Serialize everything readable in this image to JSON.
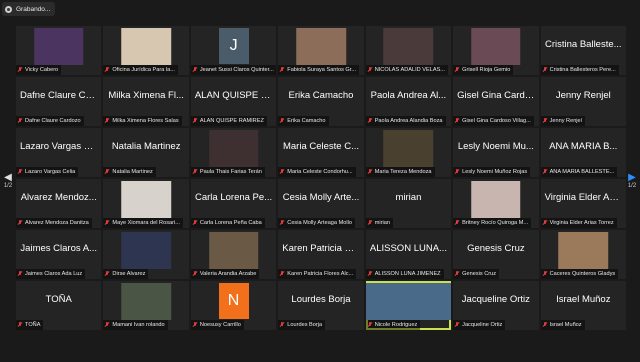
{
  "recording": {
    "label": "Grabando..."
  },
  "pager": {
    "left": "1/2",
    "right": "1/2"
  },
  "tiles": [
    {
      "type": "video",
      "name": "Vicky Cabero",
      "photo": "#4b3560"
    },
    {
      "type": "video",
      "name": "Oficina Jurídica Para la...",
      "photo": "#d7c7b0"
    },
    {
      "type": "avatar",
      "initial": "J",
      "name": "Jeanet Sussi Claros Quinter..."
    },
    {
      "type": "video",
      "name": "Fabiola Suraya Santos Gr...",
      "photo": "#8b6d5a"
    },
    {
      "type": "video",
      "name": "NICOLAS ADALID VELAS...",
      "photo": "#4a3a3a"
    },
    {
      "type": "video",
      "name": "Grisell Rioja Gemio",
      "photo": "#6a4a55"
    },
    {
      "type": "text",
      "big": "Cristina Balleste...",
      "name": "Cristina Ballesteros Pere..."
    },
    {
      "type": "text",
      "big": "Dafne Claure Ca...",
      "name": "Dafne Claure Cardozo"
    },
    {
      "type": "text",
      "big": "Milka Ximena Fl...",
      "name": "Milka Ximena Flores Salas"
    },
    {
      "type": "text",
      "big": "ALAN QUISPE R...",
      "name": "ALAN QUISPE RAMIREZ"
    },
    {
      "type": "text",
      "big": "Erika Camacho",
      "name": "Erika Camacho"
    },
    {
      "type": "text",
      "big": "Paola Andrea Al...",
      "name": "Paola Andrea Alandia Boza"
    },
    {
      "type": "text",
      "big": "Gisel Gina Cardo...",
      "name": "Gisel Gina Cardoso Villag..."
    },
    {
      "type": "text",
      "big": "Jenny Renjel",
      "name": "Jenny Renjel"
    },
    {
      "type": "text",
      "big": "Lazaro Vargas C...",
      "name": "Lazaro Vargas Celia"
    },
    {
      "type": "text",
      "big": "Natalia Martinez",
      "name": "Natalia Martinez"
    },
    {
      "type": "video",
      "name": "Paula Thais Farias Terán",
      "photo": "#3e3030"
    },
    {
      "type": "text",
      "big": "Maria Celeste C...",
      "name": "Maria Celeste Condorhu..."
    },
    {
      "type": "video",
      "name": "Maria Tereza Mendoza",
      "photo": "#4a4030"
    },
    {
      "type": "text",
      "big": "Lesly Noemi Mu...",
      "name": "Lesly Noemi Muñoz Rojas"
    },
    {
      "type": "text",
      "big": "ANA MARIA  B...",
      "name": "ANA MARIA  BALLESTE..."
    },
    {
      "type": "text",
      "big": "Alvarez Mendoz...",
      "name": "Alvarez Mendoza Danitza"
    },
    {
      "type": "video",
      "name": "Maye Xiomara del Rosari...",
      "photo": "#d8d2cc"
    },
    {
      "type": "text",
      "big": "Carla Lorena Pe...",
      "name": "Carla Lorena Peña Caba"
    },
    {
      "type": "text",
      "big": "Cesia Molly Arte...",
      "name": "Cesia Molly Arteaga Mollo"
    },
    {
      "type": "text",
      "big": "mirian",
      "name": "mirian"
    },
    {
      "type": "video",
      "name": "Britney Rocío Quiroga M...",
      "photo": "#c9b5b0"
    },
    {
      "type": "text",
      "big": "Virginia Elder Ari...",
      "name": "Virginia Elder Arias Torrez"
    },
    {
      "type": "text",
      "big": "Jaimes Claros A...",
      "name": "Jaimes Claros Ada Luz"
    },
    {
      "type": "video",
      "name": "Dirse Alvarez",
      "photo": "#2e3550"
    },
    {
      "type": "video",
      "name": "Valeria Arandia Arzabe",
      "photo": "#6a5a45"
    },
    {
      "type": "text",
      "big": "Karen Patricia Fl...",
      "name": "Karen Patricia Flores Alc..."
    },
    {
      "type": "text",
      "big": "ALISSON LUNA...",
      "name": "ALISSON LUNA JIMENEZ"
    },
    {
      "type": "text",
      "big": "Genesis Cruz",
      "name": "Genesis Cruz"
    },
    {
      "type": "video",
      "name": "Caceres Quinteros Gladys",
      "photo": "#9a7a5a"
    },
    {
      "type": "text",
      "big": "TOÑA",
      "name": "TOÑA"
    },
    {
      "type": "video",
      "name": "Mamani Ivan rolando",
      "photo": "#4a5545"
    },
    {
      "type": "avatar-orange",
      "initial": "N",
      "name": "Noesusy Carrillo"
    },
    {
      "type": "text",
      "big": "Lourdes Borja",
      "name": "Lourdes Borja"
    },
    {
      "type": "video-wide",
      "name": "Nicole Rodriguez",
      "photo": "#4a6a8a",
      "speaking": true
    },
    {
      "type": "text",
      "big": "Jacqueline Ortiz",
      "name": "Jacqueline Ortiz"
    },
    {
      "type": "text",
      "big": "Israel Muñoz",
      "name": "Israel Muñoz"
    }
  ]
}
